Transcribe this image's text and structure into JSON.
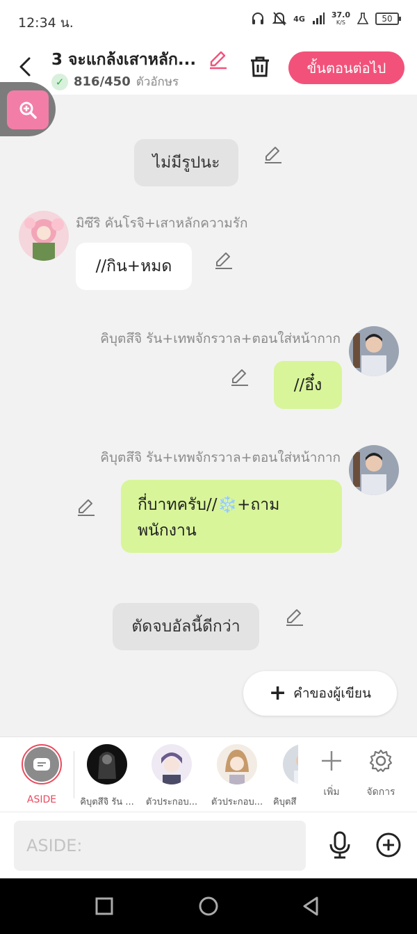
{
  "status_bar": {
    "time": "12:34 น.",
    "network": "4G",
    "speed_value": "37.0",
    "speed_unit": "K/S",
    "battery": "50"
  },
  "header": {
    "title": "3 จะแกล้งเสาหลัก...",
    "count": "816/450",
    "count_unit": "ตัวอักษร",
    "next_label": "ขั้นตอนต่อไป"
  },
  "messages": {
    "narration1": "ไม่มีรูปนะ",
    "msg1_name": "มิซึริ คันโรจิ+เสาหลักความรัก",
    "msg1_text": "//กิน+หมด",
    "msg2_name": "คิบุตสึจิ รัน+เทพจักรวาล+ตอนใส่หน้ากาก",
    "msg2_text": "//อึ๋ง",
    "msg3_name": "คิบุตสึจิ รัน+เทพจักรวาล+ตอนใส่หน้ากาก",
    "msg3_line1": "กี่บาทครับ//",
    "msg3_emoji": "❄️",
    "msg3_line1b": "+ถาม",
    "msg3_line2": "พนักงาน",
    "narration2": "ตัดจบอัลนี้ดีกว่า"
  },
  "writer_button": "คำของผู้เขียน",
  "characters": [
    {
      "label": "ASIDE"
    },
    {
      "label": "คิบุตสึจิ รัน ..."
    },
    {
      "label": "ตัวประกอบ..."
    },
    {
      "label": "ตัวประกอบ..."
    },
    {
      "label": "คิบุตสึ"
    }
  ],
  "tools": {
    "add_label": "เพิ่ม",
    "manage_label": "จัดการ"
  },
  "input": {
    "placeholder": "ASIDE:"
  },
  "colors": {
    "accent": "#f2527a",
    "green_bubble": "#d8f59a",
    "aside_ring": "#ea4a5d"
  }
}
